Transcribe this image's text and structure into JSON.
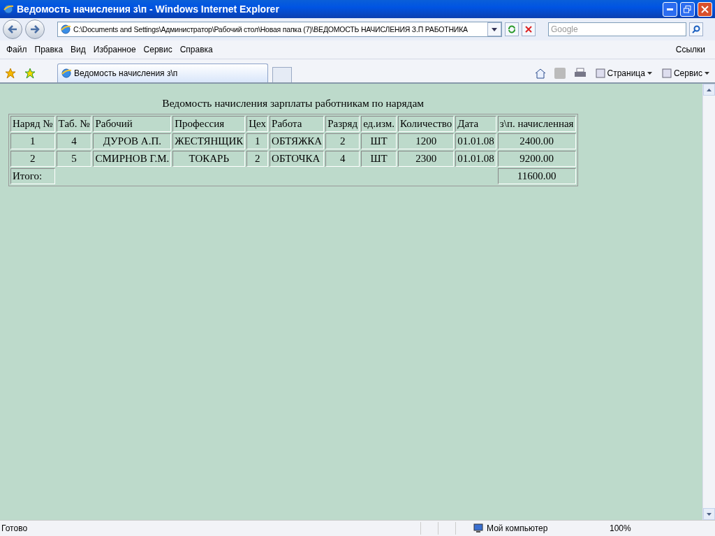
{
  "window": {
    "title": "Ведомость начисления з\\п - Windows Internet Explorer"
  },
  "address_bar": {
    "value": "C:\\Documents and Settings\\Администратор\\Рабочий стол\\Новая папка (7)\\ВЕДОМОСТЬ НАЧИСЛЕНИЯ З.П РАБОТНИКА"
  },
  "search": {
    "placeholder": "Google"
  },
  "menu": [
    "Файл",
    "Правка",
    "Вид",
    "Избранное",
    "Сервис",
    "Справка"
  ],
  "links_label": "Ссылки",
  "tab": {
    "title": "Ведомость начисления з\\п"
  },
  "command_bar": [
    "Страница",
    "Сервис"
  ],
  "report": {
    "title": "Ведомость начисления зарплаты работникам по нарядам",
    "columns": [
      "Наряд №",
      "Таб. №",
      "Рабочий",
      "Профессия",
      "Цех",
      "Работа",
      "Разряд",
      "ед.изм.",
      "Количество",
      "Дата",
      "з\\п. начисленная"
    ],
    "rows": [
      [
        "1",
        "4",
        "ДУРОВ А.П.",
        "ЖЕСТЯНЩИК",
        "1",
        "ОБТЯЖКА",
        "2",
        "ШТ",
        "1200",
        "01.01.08",
        "2400.00"
      ],
      [
        "2",
        "5",
        "СМИРНОВ Г.М.",
        "ТОКАРЬ",
        "2",
        "ОБТОЧКА",
        "4",
        "ШТ",
        "2300",
        "01.01.08",
        "9200.00"
      ]
    ],
    "total_label": "Итого:",
    "total_value": "11600.00"
  },
  "status_bar": {
    "text": "Готово",
    "zone": "Мой компьютер",
    "zoom": "100%"
  }
}
